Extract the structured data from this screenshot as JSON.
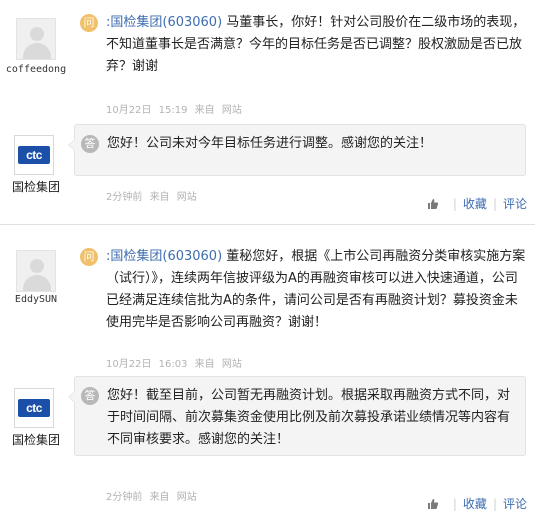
{
  "threads": [
    {
      "user": {
        "name": "coffeedong"
      },
      "question": {
        "badge": "问",
        "company": ":国检集团(603060)",
        "text": " 马董事长，你好！针对公司股价在二级市场的表现，不知道董事长是否满意？今年的目标任务是否已调整？股权激励是否已放弃？谢谢",
        "date": "10月22日",
        "time": "15:19",
        "from_label": "来自",
        "source": "网站"
      },
      "answer": {
        "badge": "答",
        "company_name": "国检集团",
        "logo_text": "ctc",
        "text": "您好！公司未对今年目标任务进行调整。感谢您的关注！",
        "time_ago": "2分钟前",
        "from_label": "来自",
        "source": "网站"
      },
      "actions": {
        "collect": "收藏",
        "comment": "评论"
      }
    },
    {
      "user": {
        "name": "EddySUN"
      },
      "question": {
        "badge": "问",
        "company": ":国检集团(603060)",
        "text": " 董秘您好，根据《上市公司再融资分类审核实施方案（试行）》，连续两年信披评级为A的再融资审核可以进入快速通道，公司已经满足连续信批为A的条件，请问公司是否有再融资计划？募投资金未使用完毕是否影响公司再融资？谢谢！",
        "date": "10月22日",
        "time": "16:03",
        "from_label": "来自",
        "source": "网站"
      },
      "answer": {
        "badge": "答",
        "company_name": "国检集团",
        "logo_text": "ctc",
        "text": "您好！截至目前，公司暂无再融资计划。根据采取再融资方式不同，对于时间间隔、前次募集资金使用比例及前次募投承诺业绩情况等内容有不同审核要求。感谢您的关注！",
        "time_ago": "2分钟前",
        "from_label": "来自",
        "source": "网站"
      },
      "actions": {
        "collect": "收藏",
        "comment": "评论"
      }
    }
  ],
  "colors": {
    "link": "#3d6db0",
    "ask_badge": "#f0c06a",
    "answer_badge": "#b8b8b8",
    "logo": "#1b4fa8"
  }
}
